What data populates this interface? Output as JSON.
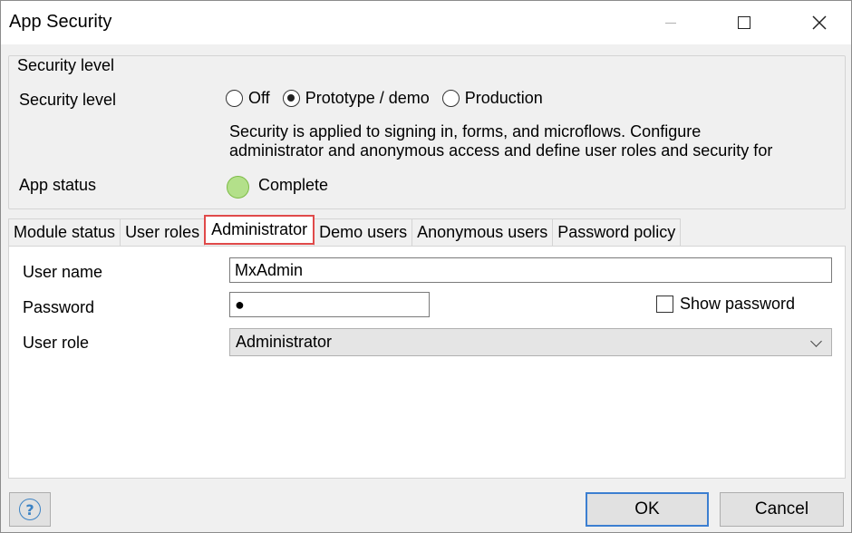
{
  "window": {
    "title": "App Security"
  },
  "security": {
    "group_title": "Security level",
    "level_label": "Security level",
    "options": [
      "Off",
      "Prototype / demo",
      "Production"
    ],
    "selected": "Prototype / demo",
    "description_line1": "Security is applied to signing in, forms, and microflows. Configure",
    "description_line2": "administrator and anonymous access and define user roles and security for",
    "status_label": "App status",
    "status_value": "Complete",
    "status_color": "#b3e08a"
  },
  "tabs": [
    {
      "label": "Module status"
    },
    {
      "label": "User roles"
    },
    {
      "label": "Administrator"
    },
    {
      "label": "Demo users"
    },
    {
      "label": "Anonymous users"
    },
    {
      "label": "Password policy"
    }
  ],
  "active_tab": "Administrator",
  "admin": {
    "username_label": "User name",
    "username_value": "MxAdmin",
    "password_label": "Password",
    "password_value": "●",
    "show_password_label": "Show password",
    "role_label": "User role",
    "role_value": "Administrator"
  },
  "footer": {
    "help_icon": "help-icon",
    "ok_label": "OK",
    "cancel_label": "Cancel"
  },
  "colors": {
    "active_tab_highlight": "#e04a4a",
    "ok_button_border": "#3c7fd1"
  }
}
